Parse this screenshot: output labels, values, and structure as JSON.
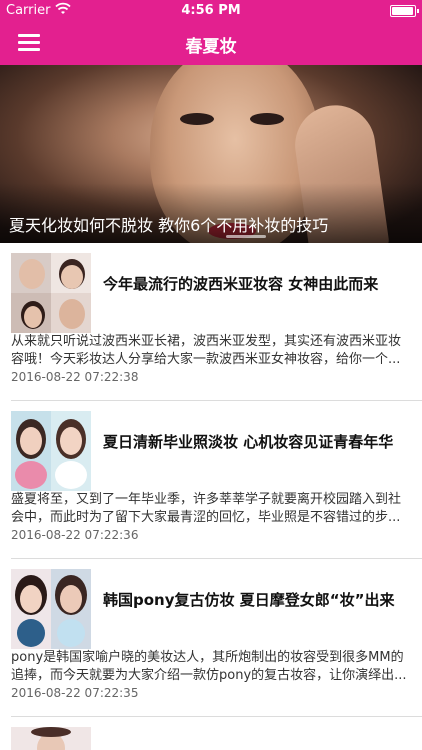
{
  "status": {
    "carrier": "Carrier",
    "time": "4:56 PM"
  },
  "nav": {
    "title": "春夏妆"
  },
  "banner": {
    "caption": "夏天化妆如何不脱妆 教你6个不用补妆的技巧"
  },
  "articles": [
    {
      "title": "今年最流行的波西米亚妆容 女神由此而来",
      "summary": "从来就只听说过波西米亚长裙，波西米亚发型，其实还有波西米亚妆容哦！今天彩妆达人分享给大家一款波西米亚女神妆容，给你一个...",
      "date": "2016-08-22 07:22:38"
    },
    {
      "title": "夏日清新毕业照淡妆 心机妆容见证青春年华",
      "summary": "盛夏将至，又到了一年毕业季，许多莘莘学子就要离开校园踏入到社会中，而此时为了留下大家最青涩的回忆，毕业照是不容错过的步...",
      "date": "2016-08-22 07:22:36"
    },
    {
      "title": "韩国pony复古仿妆 夏日摩登女郎“妆”出来",
      "summary": "pony是韩国家喻户晓的美妆达人，其所炮制出的妆容受到很多MM的追捧，而今天就要为大家介绍一款仿pony的复古妆容，让你演绎出...",
      "date": "2016-08-22 07:22:35"
    }
  ],
  "colors": {
    "brand": "#e3208f"
  }
}
